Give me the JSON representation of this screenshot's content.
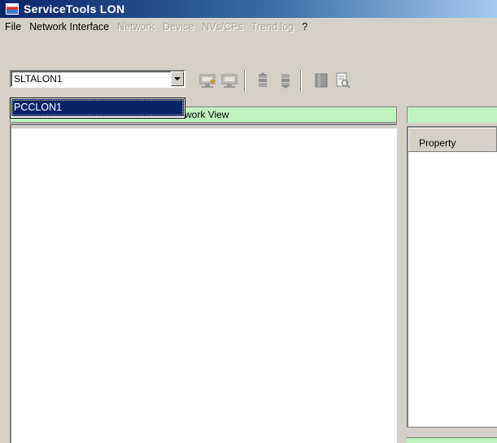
{
  "window": {
    "title": "ServiceTools LON",
    "icon": "servicetools-app-icon"
  },
  "menubar": {
    "items": [
      {
        "label": "File",
        "enabled": true
      },
      {
        "label": "Network Interface",
        "enabled": true
      },
      {
        "label": "Network",
        "enabled": false
      },
      {
        "label": "Device",
        "enabled": false
      },
      {
        "label": "NVs/CPs",
        "enabled": false
      },
      {
        "label": "Trend log",
        "enabled": false
      },
      {
        "label": "?",
        "enabled": true
      }
    ]
  },
  "toolbar": {
    "interface_combo": {
      "value": "SLTALON1",
      "options": [
        "PCCLON1"
      ],
      "highlighted_option": "PCCLON1"
    },
    "buttons": [
      {
        "name": "connect-network-icon"
      },
      {
        "name": "disconnect-network-icon"
      },
      {
        "name": "device-up-icon"
      },
      {
        "name": "device-down-icon"
      },
      {
        "name": "book-icon"
      },
      {
        "name": "report-preview-icon"
      }
    ]
  },
  "left_panel": {
    "header": "work View"
  },
  "right_panel": {
    "column_header": "Property"
  },
  "colors": {
    "titlebar_start": "#0a246a",
    "titlebar_end": "#a6caf0",
    "header_green": "#bff2bf",
    "selection": "#0a246a",
    "face": "#d4d0c8"
  }
}
